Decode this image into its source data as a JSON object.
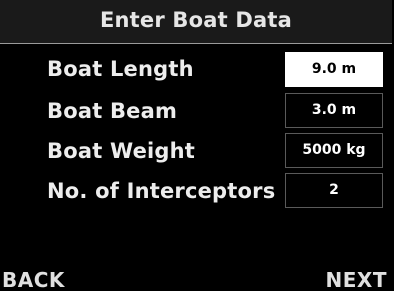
{
  "title": "Enter Boat Data",
  "rows": [
    {
      "label": "Boat Length",
      "value": "9.0 m",
      "selected": true
    },
    {
      "label": "Boat Beam",
      "value": "3.0 m",
      "selected": false
    },
    {
      "label": "Boat Weight",
      "value": "5000 kg",
      "selected": false
    },
    {
      "label": "No. of Interceptors",
      "value": "2",
      "selected": false
    }
  ],
  "softkeys": {
    "back": "BACK",
    "next": "NEXT"
  },
  "colors": {
    "background": "#000000",
    "title_bar": "#1a1a1a",
    "text": "#ededed",
    "selected_field_bg": "#ffffff",
    "selected_field_text": "#000000"
  }
}
